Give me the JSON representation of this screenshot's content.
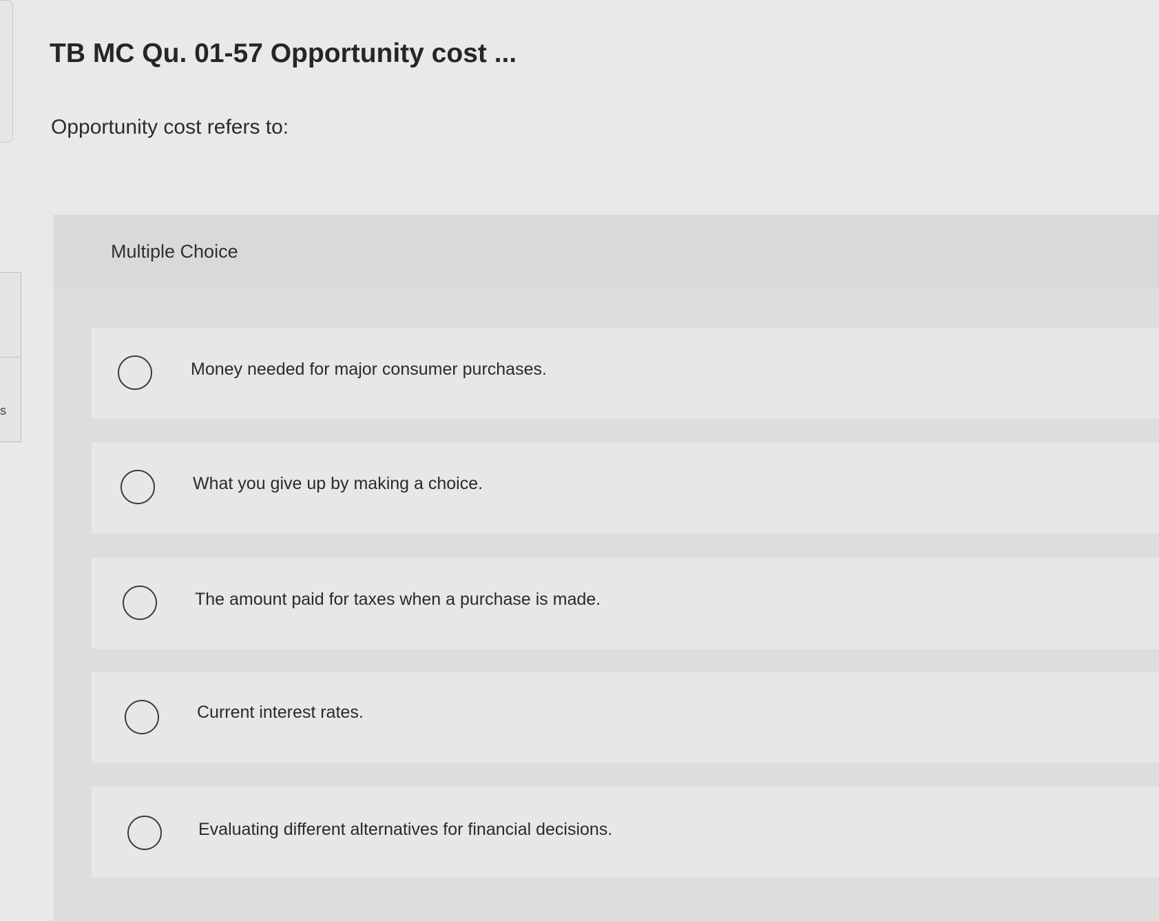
{
  "question": {
    "title": "TB MC Qu. 01-57 Opportunity cost ...",
    "prompt": "Opportunity cost refers to:"
  },
  "choices": {
    "heading": "Multiple Choice",
    "options": [
      {
        "label": "Money needed for major consumer purchases.",
        "selected": false
      },
      {
        "label": "What you give up by making a choice.",
        "selected": false
      },
      {
        "label": "The amount paid for taxes when a purchase is made.",
        "selected": false
      },
      {
        "label": "Current interest rates.",
        "selected": false
      },
      {
        "label": "Evaluating different alternatives for financial decisions.",
        "selected": false
      }
    ]
  },
  "sidebar": {
    "edge_letter": "s"
  }
}
